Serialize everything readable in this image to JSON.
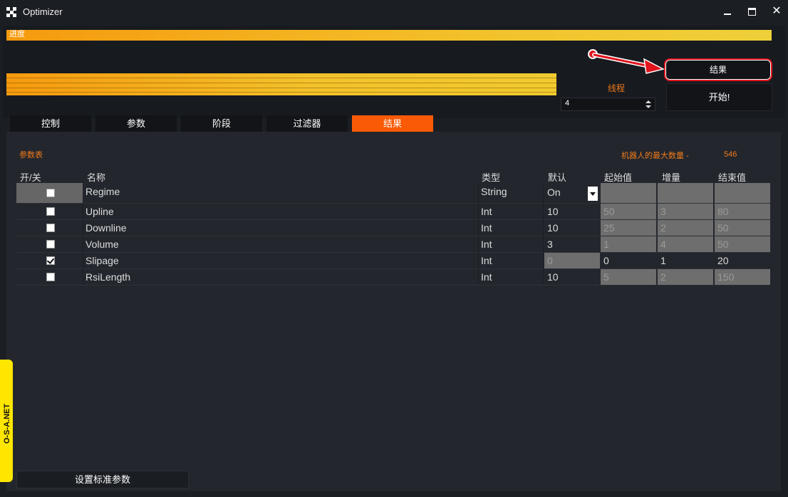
{
  "window": {
    "title": "Optimizer",
    "minimize": "–",
    "maximize": "□",
    "close": "✕"
  },
  "progress": {
    "label": "进度",
    "value_fraction": 1.0
  },
  "threads": {
    "label": "线程",
    "value": "4"
  },
  "buttons": {
    "results": "结果",
    "start": "开始!",
    "set_defaults": "设置标准参数"
  },
  "tabs": [
    {
      "label": "控制",
      "active": false
    },
    {
      "label": "参数",
      "active": false
    },
    {
      "label": "阶段",
      "active": false
    },
    {
      "label": "过滤器",
      "active": false
    },
    {
      "label": "结果",
      "active": true
    }
  ],
  "params": {
    "title": "参数表",
    "max_bots_label": "机器人的最大数量 -",
    "max_bots_value": "546",
    "headers": {
      "onoff": "开/关",
      "name": "名称",
      "type": "类型",
      "default": "默认",
      "start": "起始值",
      "step": "增量",
      "end": "结束值"
    },
    "rows": [
      {
        "checked": false,
        "name": "Regime",
        "type": "String",
        "default": "On",
        "start": "",
        "step": "",
        "end": ""
      },
      {
        "checked": false,
        "name": "Upline",
        "type": "Int",
        "default": "10",
        "start": "50",
        "step": "3",
        "end": "80"
      },
      {
        "checked": false,
        "name": "Downline",
        "type": "Int",
        "default": "10",
        "start": "25",
        "step": "2",
        "end": "50"
      },
      {
        "checked": false,
        "name": "Volume",
        "type": "Int",
        "default": "3",
        "start": "1",
        "step": "4",
        "end": "50"
      },
      {
        "checked": true,
        "name": "Slipage",
        "type": "Int",
        "default": "0",
        "start": "0",
        "step": "1",
        "end": "20"
      },
      {
        "checked": false,
        "name": "RsiLength",
        "type": "Int",
        "default": "10",
        "start": "5",
        "step": "2",
        "end": "150"
      }
    ]
  },
  "badge": {
    "text": "O-S-A.NET"
  },
  "colors": {
    "accent": "#fa5a06",
    "label_orange": "#f07a1a",
    "highlight_red": "#e0141c",
    "badge_yellow": "#ffe600"
  }
}
